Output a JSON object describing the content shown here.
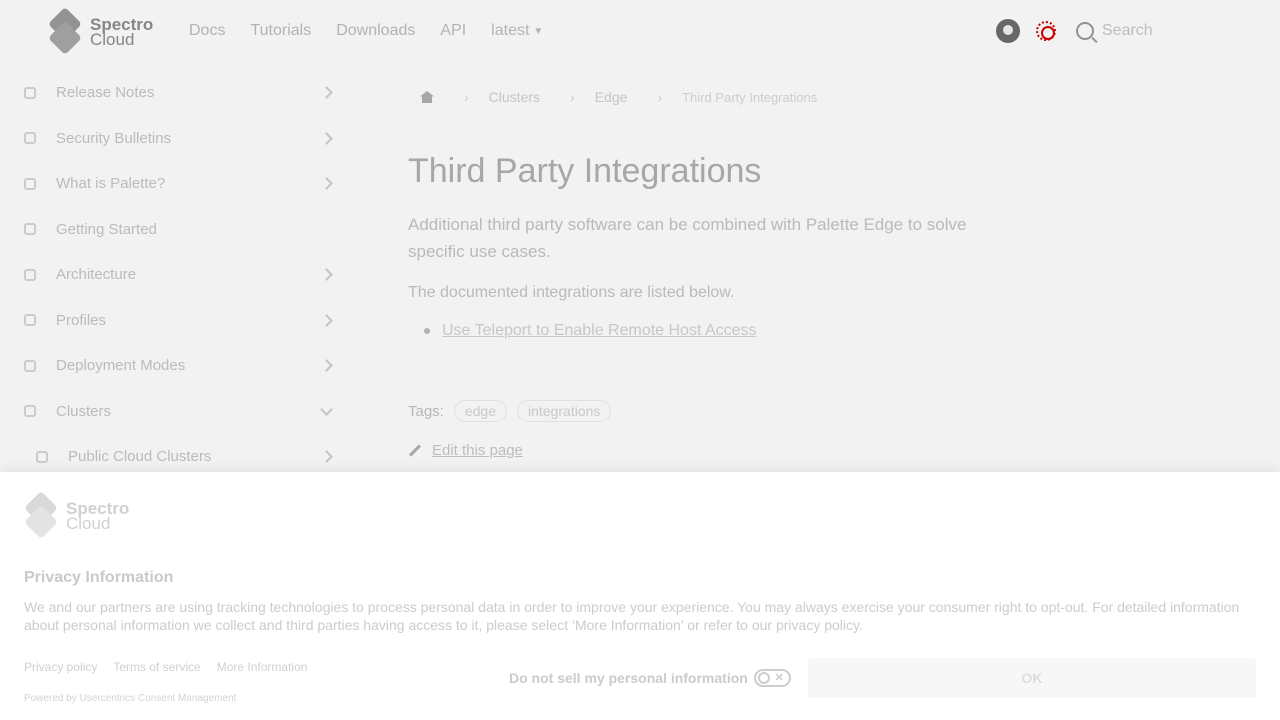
{
  "brand": {
    "line1": "Spectro",
    "line2": "Cloud"
  },
  "nav": {
    "links": [
      "Docs",
      "Tutorials",
      "Downloads",
      "API"
    ],
    "version": "latest",
    "search_label": "Search"
  },
  "sidebar": {
    "items": [
      {
        "label": "Release Notes",
        "chevron": "right"
      },
      {
        "label": "Security Bulletins",
        "chevron": "right"
      },
      {
        "label": "What is Palette?",
        "chevron": "right"
      },
      {
        "label": "Getting Started",
        "chevron": ""
      },
      {
        "label": "Architecture",
        "chevron": "right"
      },
      {
        "label": "Profiles",
        "chevron": "right"
      },
      {
        "label": "Deployment Modes",
        "chevron": "right"
      },
      {
        "label": "Clusters",
        "chevron": "down"
      },
      {
        "label": "Public Cloud Clusters",
        "chevron": "right"
      }
    ]
  },
  "breadcrumb": {
    "items": [
      "Clusters",
      "Edge"
    ],
    "current": "Third Party Integrations"
  },
  "page": {
    "title": "Third Party Integrations",
    "lead": "Additional third party software can be combined with Palette Edge to solve specific use cases.",
    "para": "The documented integrations are listed below.",
    "links": [
      "Use Teleport to Enable Remote Host Access"
    ],
    "tags_label": "Tags:",
    "tags": [
      "edge",
      "integrations"
    ],
    "edit_label": "Edit this page"
  },
  "consent": {
    "logo_line1": "Spectro",
    "logo_line2": "Cloud",
    "title": "Privacy Information",
    "body": "We and our partners are using tracking technologies to process personal data in order to improve your experience. You may always exercise your consumer right to opt-out. For detailed information about personal information we collect and third parties having access to it, please select ‘More Information’ or refer to our privacy policy.",
    "links": [
      "Privacy policy",
      "Terms of service",
      "More Information"
    ],
    "powered_by": "Powered by Usercentrics Consent Management",
    "dns_label": "Do not sell my personal information",
    "dns_enabled": false,
    "ok_label": "OK"
  }
}
